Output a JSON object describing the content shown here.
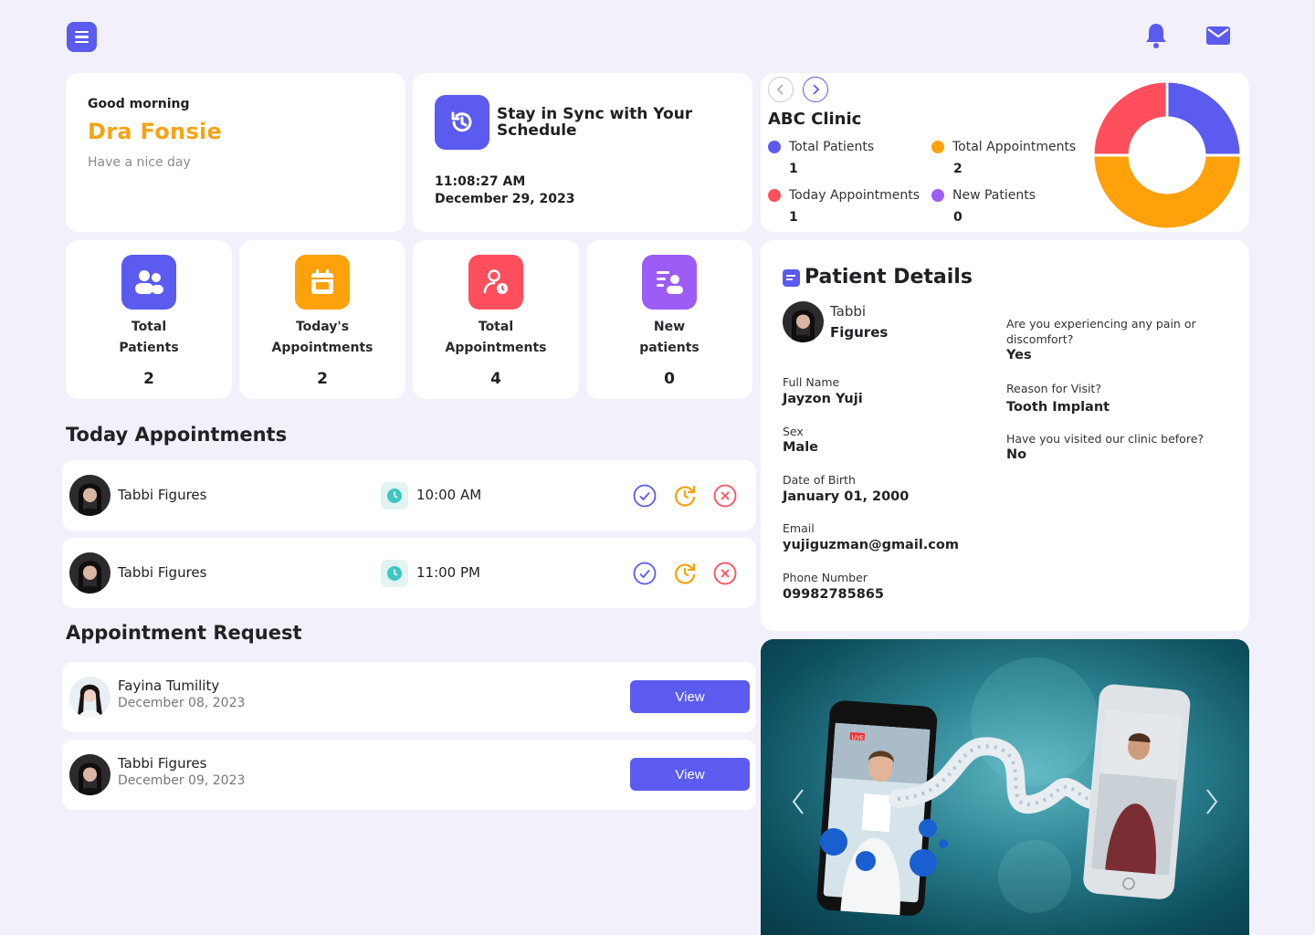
{
  "header": {
    "menu_icon": "menu-icon",
    "notification_icon": "bell-icon",
    "mail_icon": "mail-icon",
    "accent": "#5b5bf0"
  },
  "greeting": {
    "salutation": "Good morning",
    "name": "Dra Fonsie",
    "subtitle": "Have a nice day"
  },
  "schedule": {
    "title": "Stay in Sync with Your Schedule",
    "time": "11:08:27 AM",
    "date": "December 29, 2023"
  },
  "clinic": {
    "name": "ABC Clinic",
    "legend": [
      {
        "label": "Total Patients",
        "value": "1",
        "color": "#5b5bf0"
      },
      {
        "label": "Total Appointments",
        "value": "2",
        "color": "#ffa10a"
      },
      {
        "label": "Today Appointments",
        "value": "1",
        "color": "#ff4e5c"
      },
      {
        "label": "New Patients",
        "value": "0",
        "color": "#9d5cf5"
      }
    ]
  },
  "chart_data": {
    "type": "pie",
    "donut": true,
    "categories": [
      "Total Patients",
      "Total Appointments",
      "Today Appointments",
      "New Patients"
    ],
    "values": [
      1,
      2,
      1,
      0
    ],
    "colors": [
      "#5b5bf0",
      "#ffa10a",
      "#ff4e5c",
      "#9d5cf5"
    ]
  },
  "stats": [
    {
      "label_line1": "Total",
      "label_line2": "Patients",
      "value": "2",
      "color": "#5b5bf0",
      "icon": "users-icon"
    },
    {
      "label_line1": "Today's",
      "label_line2": "Appointments",
      "value": "2",
      "color": "#ffa10a",
      "icon": "calendar-icon"
    },
    {
      "label_line1": "Total",
      "label_line2": "Appointments",
      "value": "4",
      "color": "#ff4e5c",
      "icon": "user-clock-icon"
    },
    {
      "label_line1": "New",
      "label_line2": "patients",
      "value": "0",
      "color": "#9d5cf5",
      "icon": "user-list-icon"
    }
  ],
  "today_appointments": {
    "title": "Today Appointments",
    "rows": [
      {
        "name": "Tabbi Figures",
        "time": "10:00 AM"
      },
      {
        "name": "Tabbi Figures",
        "time": "11:00 PM"
      }
    ]
  },
  "appointment_request": {
    "title": "Appointment Request",
    "rows": [
      {
        "name": "Fayina Tumility",
        "date": "December 08, 2023",
        "button": "View"
      },
      {
        "name": "Tabbi Figures",
        "date": "December 09, 2023",
        "button": "View"
      }
    ]
  },
  "patient_details": {
    "title": "Patient Details",
    "first_name": "Tabbi",
    "last_name": "Figures",
    "fields": [
      {
        "label": "Full Name",
        "value": "Jayzon Yuji"
      },
      {
        "label": "Sex",
        "value": "Male"
      },
      {
        "label": "Date of Birth",
        "value": "January 01, 2000"
      },
      {
        "label": "Email",
        "value": "yujiguzman@gmail.com"
      },
      {
        "label": "Phone Number",
        "value": "09982785865"
      }
    ],
    "questions": [
      {
        "label": "Are you experiencing any pain or discomfort?",
        "value": "Yes"
      },
      {
        "label": "Reason for Visit?",
        "value": "Tooth Implant"
      },
      {
        "label": "Have you visited our clinic before?",
        "value": "No"
      }
    ]
  },
  "promo": {
    "live_badge": "LIVE"
  }
}
